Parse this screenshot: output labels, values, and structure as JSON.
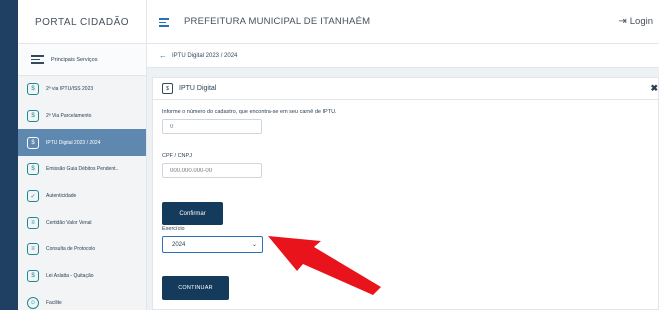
{
  "header": {
    "brand": "PORTAL CIDADÃO",
    "title": "PREFEITURA MUNICIPAL DE ITANHAÉM",
    "login": "Login"
  },
  "sidebar": {
    "header_label": "Principais Serviços",
    "items": [
      {
        "label": "2ª via IPTU/ISS 2023",
        "icon": "document-icon"
      },
      {
        "label": "2ª Via Parcelamento",
        "icon": "document-icon"
      },
      {
        "label": "IPTU Digital 2023 / 2024",
        "icon": "document-icon",
        "active": true
      },
      {
        "label": "Emissão Guia Débitos Pendent..",
        "icon": "document-icon"
      },
      {
        "label": "Autenticidade",
        "icon": "document-icon"
      },
      {
        "label": "Certidão Valor Venal",
        "icon": "document-icon"
      },
      {
        "label": "Consulta de Protocolo",
        "icon": "document-icon"
      },
      {
        "label": "Lei Aslatta - Quitação",
        "icon": "document-icon"
      },
      {
        "label": "Facilite",
        "icon": "headset-icon"
      }
    ]
  },
  "breadcrumb": "IPTU Digital 2023 / 2024",
  "card": {
    "title": "IPTU Digital",
    "info_label": "Informe o número do cadastro, que encontra-se em seu carnê de IPTU.",
    "cadastro_value": "0",
    "cpf_label": "CPF / CNPJ",
    "cpf_placeholder": "000.000.000-00",
    "confirm_label": "Confirmar",
    "exercicio_label": "Exercício",
    "exercicio_value": "2024",
    "continue_label": "CONTINUAR"
  },
  "colors": {
    "accent": "#2a72b5",
    "button": "#143a5c",
    "active_item": "#5f88b0",
    "arrow": "#e8131b"
  }
}
